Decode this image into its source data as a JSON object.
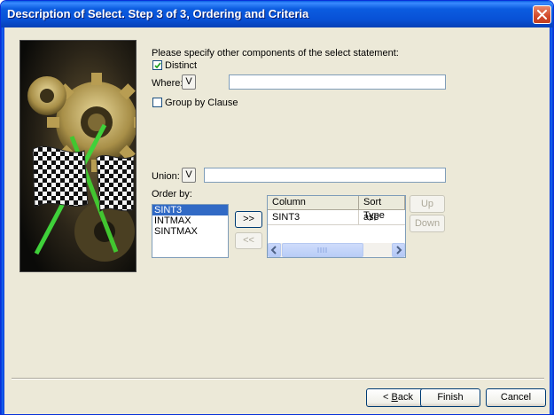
{
  "window": {
    "title": "Description of Select. Step 3 of 3, Ordering and Criteria"
  },
  "form": {
    "instruction": "Please specify other components of the select statement:",
    "distinct_label": "Distinct",
    "distinct_checked": true,
    "where_label": "Where:",
    "where_button": "V",
    "where_value": "",
    "group_by_label": "Group by Clause",
    "group_by_checked": false,
    "union_label": "Union:",
    "union_button": "V",
    "union_value": "",
    "order_by_label": "Order by:"
  },
  "order_list": {
    "items": [
      "SINT3",
      "INTMAX",
      "SINTMAX"
    ],
    "selected": "SINT3"
  },
  "move": {
    "add_label": ">>",
    "remove_label": "<<"
  },
  "order_grid": {
    "columns": [
      "Column",
      "Sort Type"
    ],
    "rows": [
      [
        "SINT3",
        "asc"
      ]
    ]
  },
  "reorder": {
    "up_label": "Up",
    "down_label": "Down"
  },
  "footer": {
    "back_prefix": "< ",
    "back_mnemonic": "B",
    "back_rest": "ack",
    "finish_label": "Finish",
    "cancel_label": "Cancel"
  },
  "icons": {
    "close": "close-icon",
    "checkmark": "checkmark-icon",
    "scroll_left": "arrow-left-icon",
    "scroll_right": "arrow-right-icon"
  }
}
